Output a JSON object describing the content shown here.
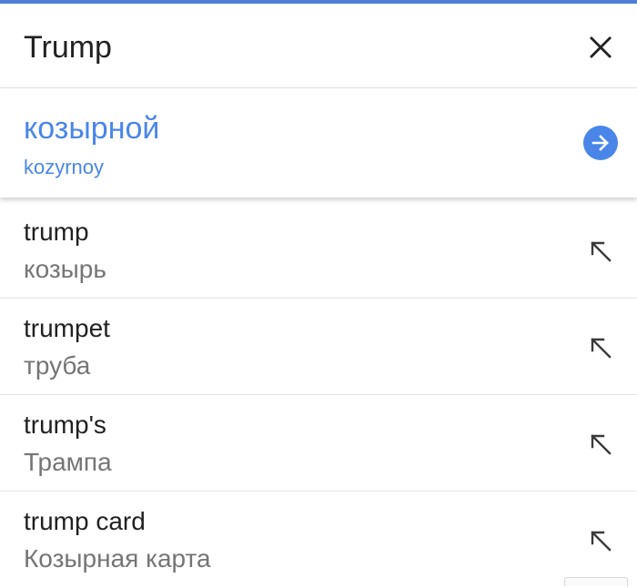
{
  "search": {
    "query": "Trump"
  },
  "translation": {
    "text": "козырной",
    "transliteration": "kozyrnoy"
  },
  "suggestions": [
    {
      "word": "trump",
      "translation": "козырь"
    },
    {
      "word": "trumpet",
      "translation": "труба"
    },
    {
      "word": "trump's",
      "translation": "Трампа"
    },
    {
      "word": "trump card",
      "translation": "Козырная карта"
    }
  ],
  "icons": {
    "close": "close-icon",
    "go": "arrow-right-icon",
    "fill": "arrow-up-left-icon"
  },
  "colors": {
    "accent": "#4a86e8",
    "primary_text": "#212121",
    "secondary_text": "#757575"
  }
}
